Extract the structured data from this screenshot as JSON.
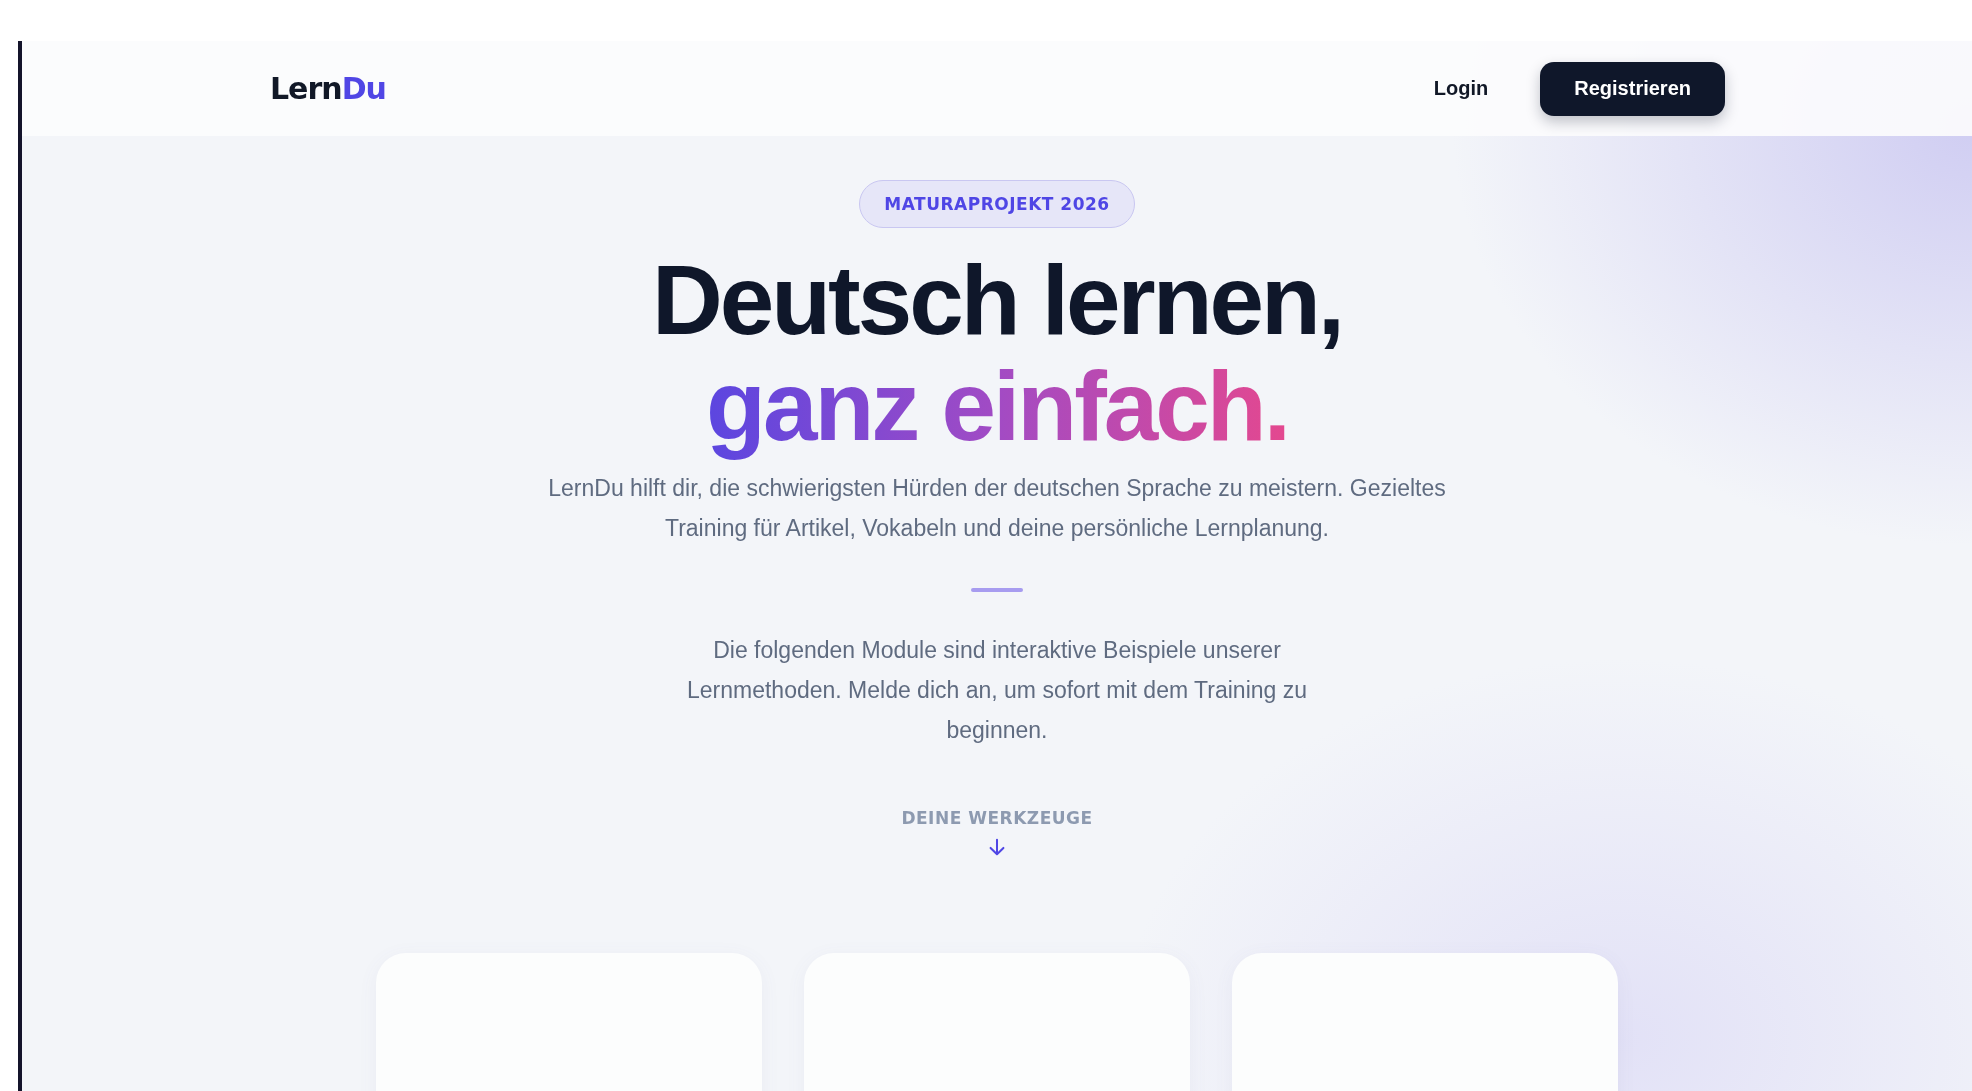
{
  "nav": {
    "logo": {
      "main": "Lern",
      "accent": "Du"
    },
    "links": [
      {
        "kind": "link",
        "label": "Login"
      },
      {
        "kind": "primary",
        "label": "Registrieren"
      }
    ]
  },
  "hero": {
    "badge": "MATURAPROJEKT 2026",
    "title_line_1": "Deutsch lernen,",
    "title_line_2": "ganz einfach.",
    "intro": "LernDu hilft dir, die schwierigsten Hürden der deutschen Sprache zu meistern. Gezieltes Training für Artikel, Vokabeln und deine persönliche Lernplanung.",
    "note": "Die folgenden Module sind interaktive Beispiele unserer Lernmethoden. Melde dich an, um sofort mit dem Training zu beginnen.",
    "scroll_hint": "DEINE WERKZEUGE"
  }
}
